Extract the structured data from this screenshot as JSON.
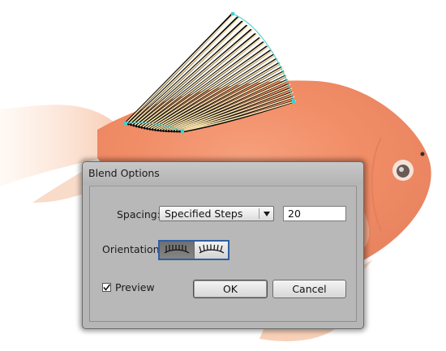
{
  "dialog": {
    "title": "Blend Options",
    "spacing": {
      "label": "Spacing:",
      "selected": "Specified Steps",
      "steps_value": "20"
    },
    "orientation": {
      "label": "Orientation:"
    },
    "preview": {
      "label": "Preview",
      "checked": true
    },
    "buttons": {
      "ok": "OK",
      "cancel": "Cancel"
    }
  },
  "icons": {
    "orientation_align_page": "align-to-page-icon",
    "orientation_align_path": "align-to-path-icon",
    "dropdown": "chevron-down-icon",
    "check": "checkmark-icon"
  },
  "colors": {
    "fish_body": "#f08f6a",
    "fish_belly": "#fbd6c0",
    "fin_light": "#ffe7b0",
    "fin_dark": "#0a0a0a",
    "path_handles": "#3fd0d0",
    "dialog_bg": "#b6b6b6",
    "orientation_focus": "#2f5fa2"
  }
}
